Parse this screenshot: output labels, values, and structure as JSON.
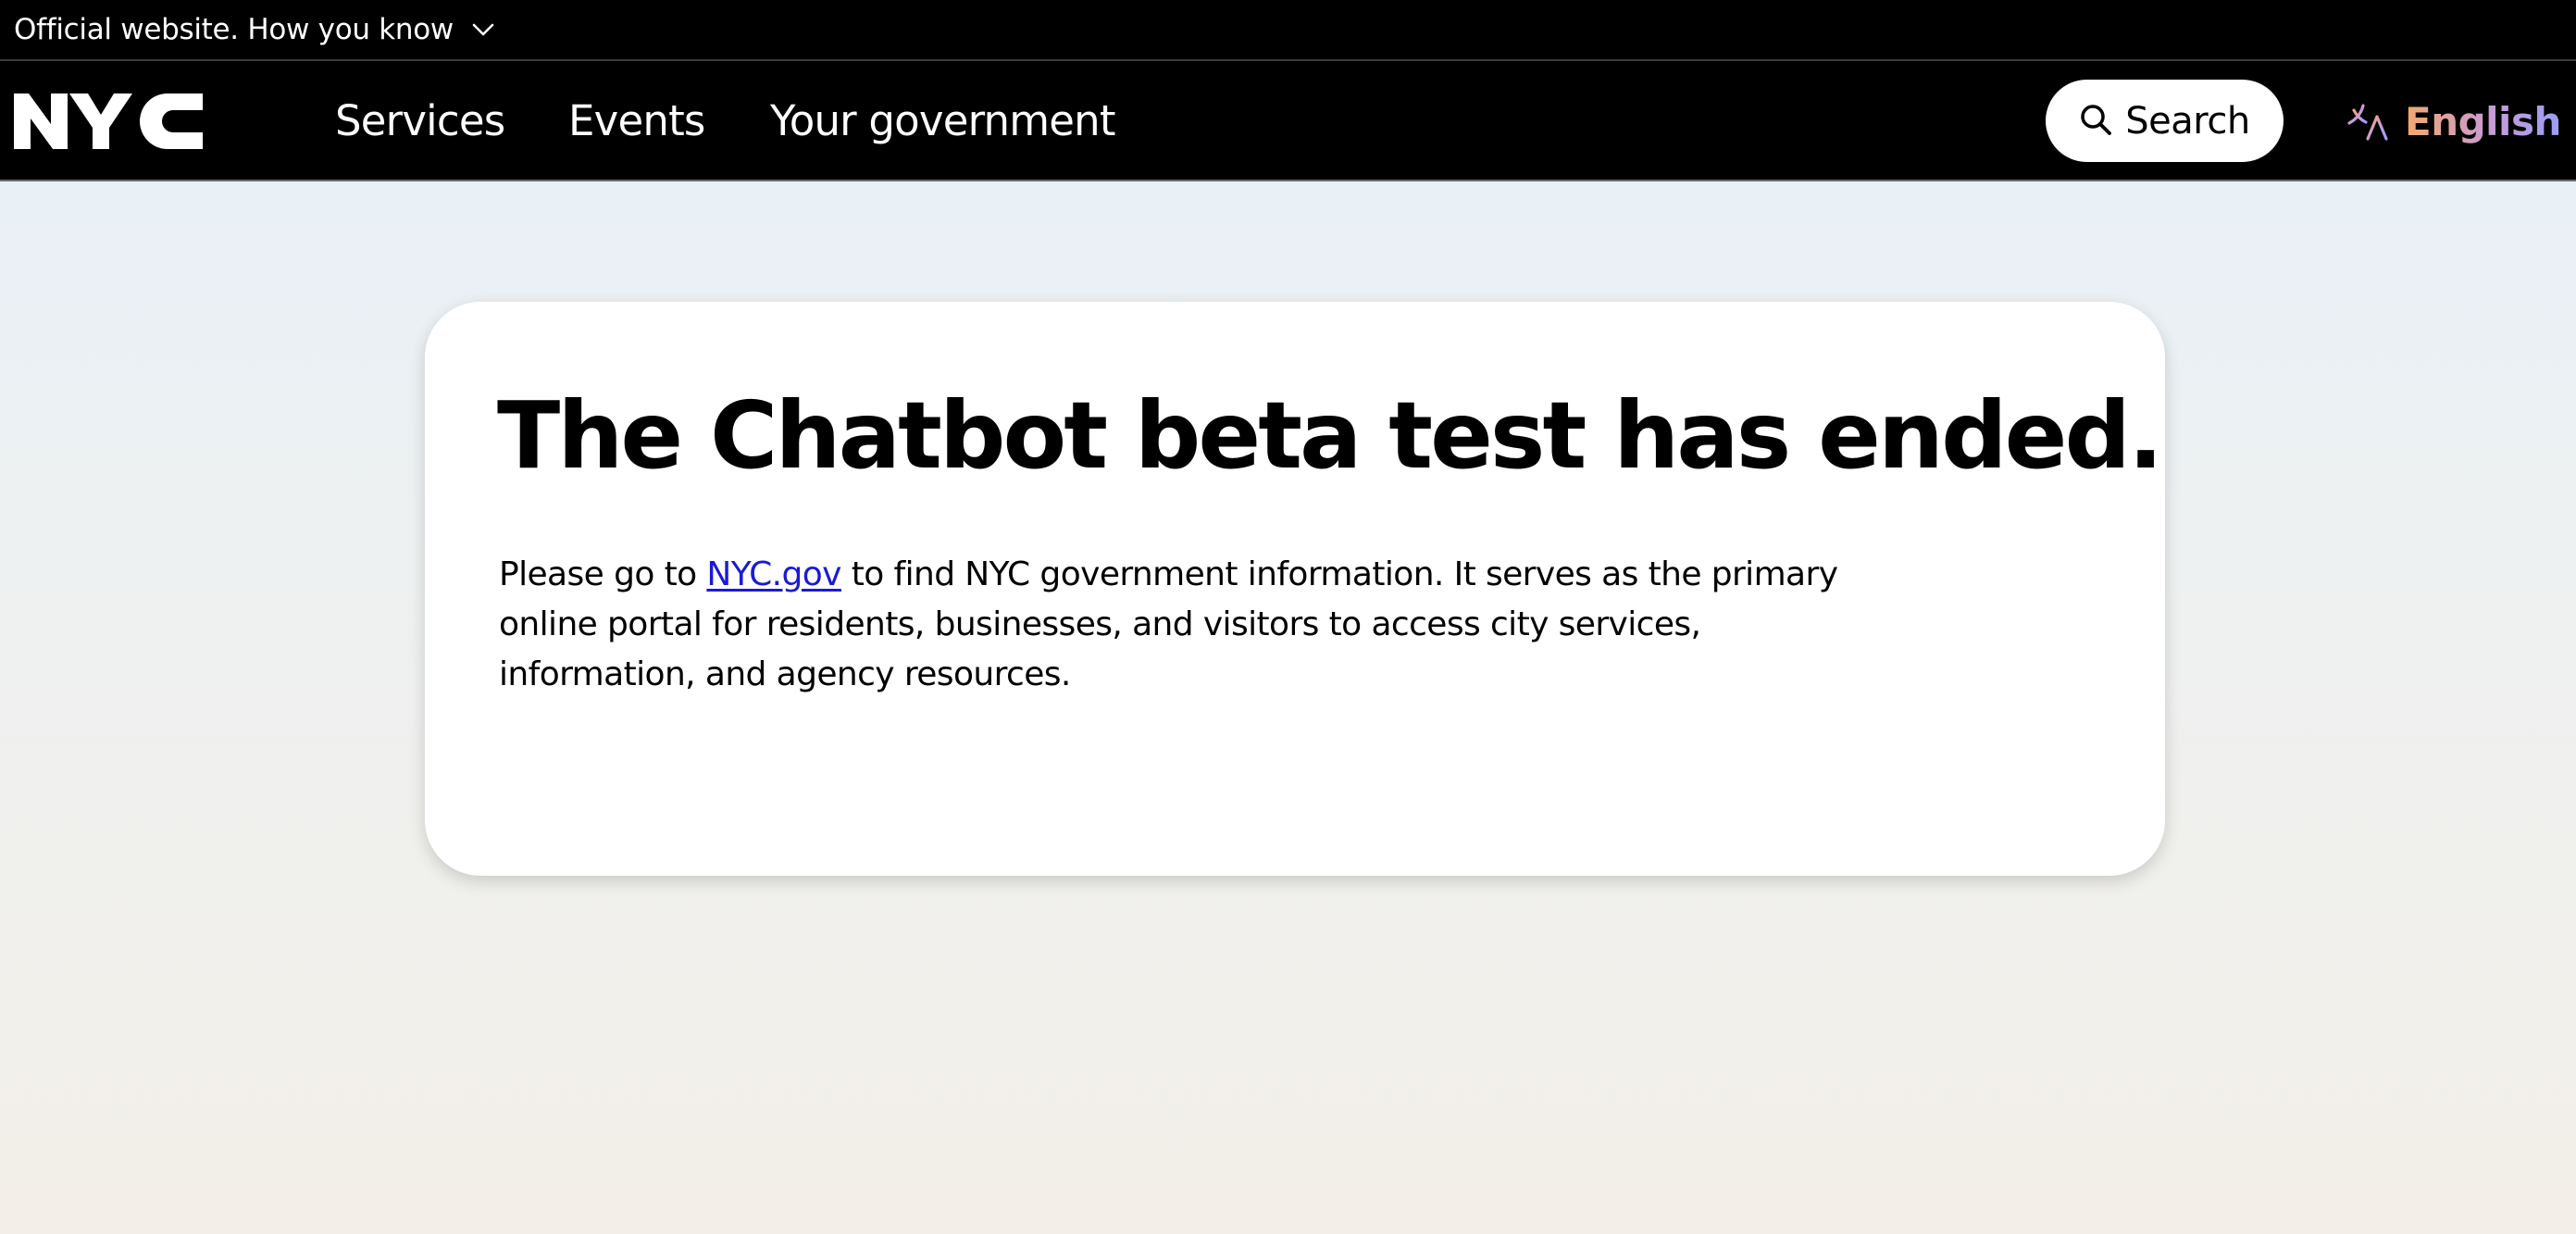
{
  "banner": {
    "official_text": "Official website. How you know"
  },
  "navbar": {
    "logo_text": "NYC",
    "items": [
      {
        "label": "Services"
      },
      {
        "label": "Events"
      },
      {
        "label": "Your government"
      }
    ],
    "search_label": "Search",
    "language_label": "English"
  },
  "card": {
    "title": "The Chatbot beta test has ended.",
    "body_before_link": "Please go to ",
    "link_text": "NYC.gov",
    "body_after_link": " to find NYC government information. It serves as the primary online portal for residents, businesses, and visitors to access city services, information, and agency resources."
  },
  "colors": {
    "header_bg": "#000000",
    "link": "#1a1ad6",
    "language_gradient": [
      "#f3a86c",
      "#c89bd6",
      "#9b9ef5"
    ]
  },
  "icons": {
    "banner_toggle": "chevron-down-icon",
    "search": "search-icon",
    "language": "translate-icon"
  }
}
